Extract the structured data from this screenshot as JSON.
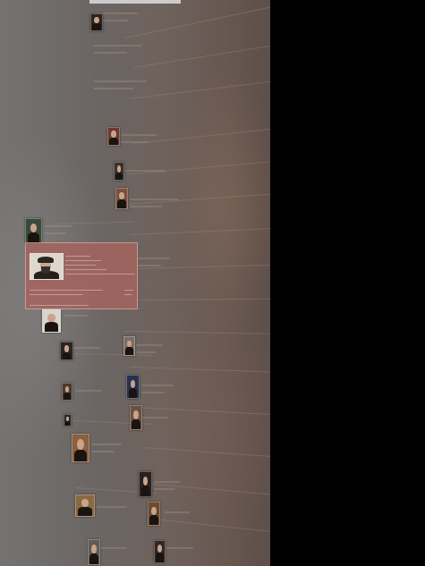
{
  "timeline": {
    "portraits": [
      {
        "name": "portrait-1",
        "bg": "#2a2420"
      },
      {
        "name": "portrait-2",
        "bg": "#6a3a30"
      },
      {
        "name": "portrait-3",
        "bg": "#3a3230"
      },
      {
        "name": "portrait-4",
        "bg": "#7a5040"
      },
      {
        "name": "portrait-5",
        "bg": "#3a4a3a"
      },
      {
        "name": "portrait-6",
        "bg": "#d8d4ce"
      },
      {
        "name": "portrait-7",
        "bg": "#2a2520"
      },
      {
        "name": "portrait-8",
        "bg": "#7a6e66"
      },
      {
        "name": "portrait-9",
        "bg": "#4a3a30"
      },
      {
        "name": "portrait-10",
        "bg": "#2a3050"
      },
      {
        "name": "portrait-11",
        "bg": "#2a2a2a"
      },
      {
        "name": "portrait-12",
        "bg": "#6a5040"
      },
      {
        "name": "portrait-13",
        "bg": "#8a6040"
      },
      {
        "name": "portrait-14",
        "bg": "#2a2020"
      },
      {
        "name": "portrait-15",
        "bg": "#8a6a40"
      },
      {
        "name": "portrait-16",
        "bg": "#6a4a30"
      },
      {
        "name": "portrait-17",
        "bg": "#605a58"
      },
      {
        "name": "portrait-18",
        "bg": "#302828"
      }
    ],
    "popup": {
      "colors": {
        "background": "#a5645f",
        "border": "#d7a096"
      }
    }
  },
  "colors": {
    "page_background": "#000000"
  }
}
